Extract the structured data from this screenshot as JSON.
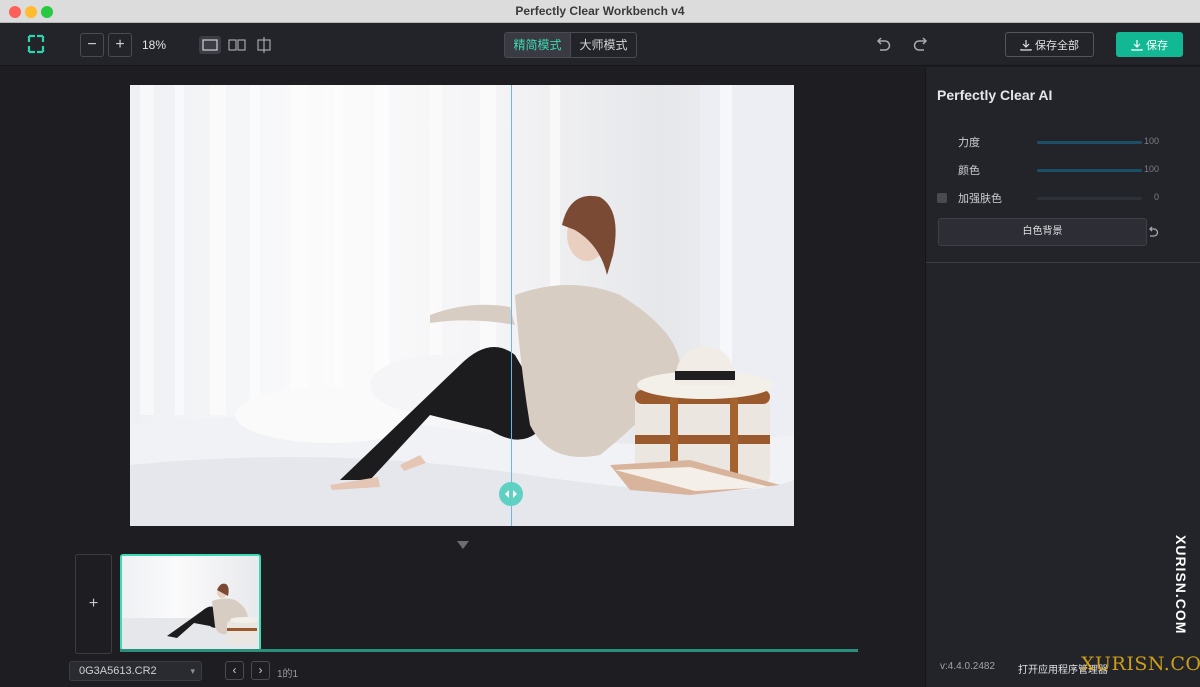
{
  "window": {
    "title": "Perfectly Clear Workbench v4"
  },
  "toolbar": {
    "zoom_out": "−",
    "zoom_in": "+",
    "zoom_level": "18%",
    "view_modes": [
      "single-view-icon",
      "split-view-icon",
      "crop-view-icon"
    ],
    "modes": [
      "精简模式",
      "大师模式"
    ],
    "active_mode": "精简模式",
    "save_all_label": "保存全部",
    "save_label": "保存",
    "accent_color": "#12b893"
  },
  "canvas": {
    "image": "photo-preview",
    "split_view": true
  },
  "filmstrip": {
    "add_label": "+",
    "selected_file": "0G3A5613.CR2",
    "page_count": "1的1",
    "prev": "‹",
    "next": "›"
  },
  "panel": {
    "title": "Perfectly Clear AI",
    "sliders": [
      {
        "label": "力度",
        "value": "100",
        "fraction": 1.0
      },
      {
        "label": "颜色",
        "value": "100",
        "fraction": 1.0
      },
      {
        "label": "加强肤色",
        "value": "0",
        "fraction": 0.0,
        "checkbox": true,
        "checked": false
      }
    ],
    "background_button": "白色背景",
    "version": "v:4.4.0.2482",
    "open_manager": "打开应用程序管理器"
  },
  "watermark": {
    "vertical": "XURISN.COM",
    "horizontal": "XURISN.COM"
  }
}
